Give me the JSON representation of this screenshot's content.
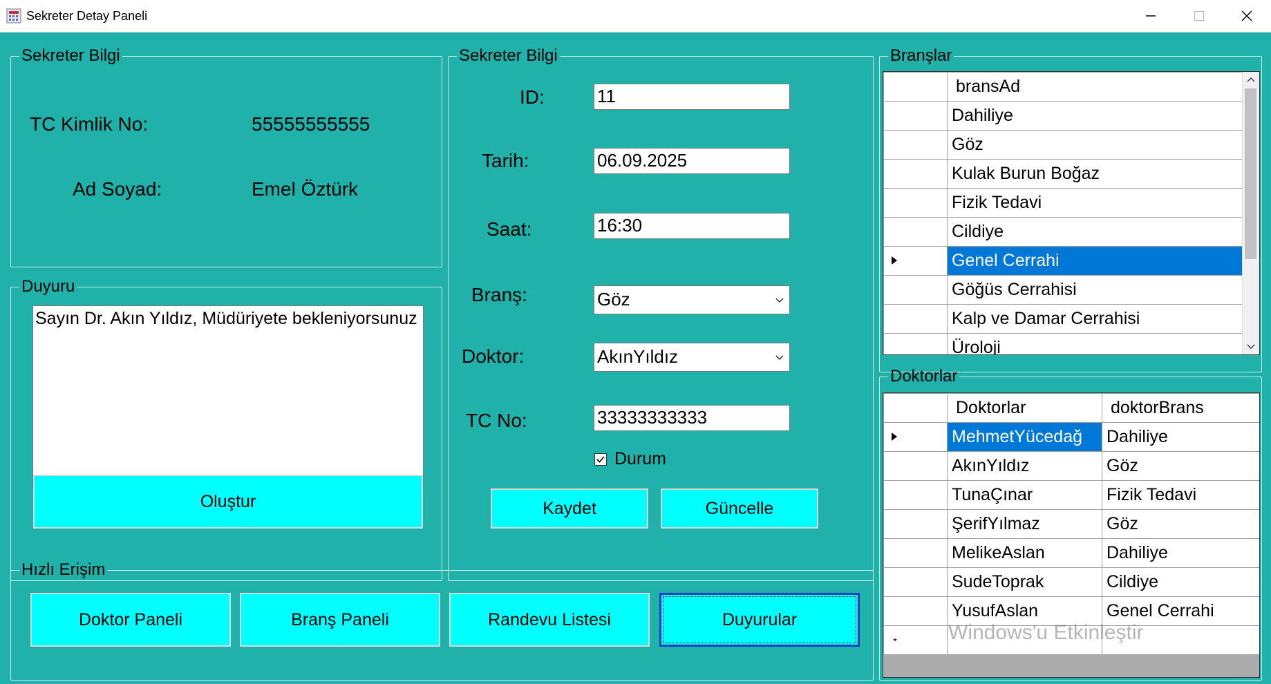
{
  "window": {
    "title": "Sekreter Detay Paneli"
  },
  "info": {
    "legend": "Sekreter Bilgi",
    "tc_label": "TC Kimlik No:",
    "tc_value": "55555555555",
    "name_label": "Ad Soyad:",
    "name_value": "Emel Öztürk"
  },
  "announce": {
    "legend": "Duyuru",
    "text": "Sayın Dr. Akın Yıldız, Müdüriyete bekleniyorsunuz",
    "create_button": "Oluştur"
  },
  "form": {
    "legend": "Sekreter Bilgi",
    "id_label": "ID:",
    "id_value": "11",
    "date_label": "Tarih:",
    "date_value": "06.09.2025",
    "time_label": "Saat:",
    "time_value": "16:30",
    "branch_label": "Branş:",
    "branch_value": "Göz",
    "doctor_label": "Doktor:",
    "doctor_value": "AkınYıldız",
    "tc_label": "TC No:",
    "tc_value": "33333333333",
    "status_label": "Durum",
    "status_checked": true,
    "save_button": "Kaydet",
    "update_button": "Güncelle"
  },
  "quick": {
    "legend": "Hızlı Erişim",
    "buttons": [
      "Doktor Paneli",
      "Branş Paneli",
      "Randevu Listesi",
      "Duyurular"
    ]
  },
  "branches": {
    "legend": "Branşlar",
    "column": "bransAd",
    "rows": [
      "Dahiliye",
      "Göz",
      "Kulak Burun Boğaz",
      "Fizik Tedavi",
      "Cildiye",
      "Genel Cerrahi",
      "Göğüs Cerrahisi",
      "Kalp ve Damar Cerrahisi",
      "Üroloji"
    ],
    "selected_index": 5
  },
  "doctors": {
    "legend": "Doktorlar",
    "columns": [
      "Doktorlar",
      "doktorBrans"
    ],
    "rows": [
      [
        "MehmetYücedağ",
        "Dahiliye"
      ],
      [
        "AkınYıldız",
        "Göz"
      ],
      [
        "TunaÇınar",
        "Fizik Tedavi"
      ],
      [
        "ŞerifYılmaz",
        "Göz"
      ],
      [
        "MelikeAslan",
        "Dahiliye"
      ],
      [
        "SudeToprak",
        "Cildiye"
      ],
      [
        "YusufAslan",
        "Genel Cerrahi"
      ]
    ],
    "selected_index": 0
  },
  "watermark": "Windows'u Etkinleştir",
  "colors": {
    "background": "#20b2aa",
    "button": "#00ffff",
    "selection": "#0078d7"
  }
}
